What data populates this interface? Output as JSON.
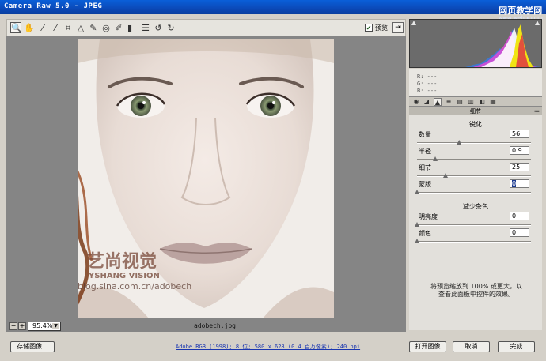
{
  "window": {
    "title": "Camera Raw 5.0 -  JPEG",
    "watermark": {
      "line1": "网页教学网",
      "line2": "www.webjx.com"
    }
  },
  "toolbar": {
    "tools": [
      {
        "icon": "zoom-icon",
        "glyph": "🔍"
      },
      {
        "icon": "hand-icon",
        "glyph": "✋"
      },
      {
        "icon": "white-balance-icon",
        "glyph": "⁄"
      },
      {
        "icon": "color-sampler-icon",
        "glyph": "⁄"
      },
      {
        "icon": "crop-icon",
        "glyph": "⌗"
      },
      {
        "icon": "straighten-icon",
        "glyph": "△"
      },
      {
        "icon": "spot-removal-icon",
        "glyph": "✎"
      },
      {
        "icon": "red-eye-icon",
        "glyph": "◎"
      },
      {
        "icon": "adjustment-brush-icon",
        "glyph": "✐"
      },
      {
        "icon": "gradient-filter-icon",
        "glyph": "▮"
      },
      {
        "icon": "preferences-icon",
        "glyph": "☰"
      },
      {
        "icon": "rotate-ccw-icon",
        "glyph": "↺"
      },
      {
        "icon": "rotate-cw-icon",
        "glyph": "↻"
      }
    ],
    "preview_label": "预览",
    "preview_checked": "✔",
    "fullscreen_glyph": "⇥"
  },
  "status": {
    "zoom_minus": "−",
    "zoom_plus": "+",
    "zoom_value": "95.4%",
    "zoom_arrow": "▼",
    "filename": "adobech.jpg"
  },
  "photo_overlay": {
    "brand_cn": "艺尚视觉",
    "brand_en": "YSHANG VISION",
    "blog": "blog.sina.com.cn/adobech"
  },
  "readout": {
    "r": "R:  ---",
    "g": "G:  ---",
    "b": "B:  ---"
  },
  "panel": {
    "title": "细节",
    "sharpen": {
      "heading": "锐化",
      "rows": [
        {
          "label": "数量",
          "value": "56",
          "pos": 0.37
        },
        {
          "label": "半径",
          "value": "0.9",
          "pos": 0.16
        },
        {
          "label": "细节",
          "value": "25",
          "pos": 0.25
        },
        {
          "label": "蒙版",
          "value": "0",
          "pos": 0.0
        }
      ]
    },
    "noise": {
      "heading": "减少杂色",
      "rows": [
        {
          "label": "明亮度",
          "value": "0",
          "pos": 0.0
        },
        {
          "label": "颜色",
          "value": "0",
          "pos": 0.0
        }
      ]
    },
    "info_line1": "将预览缩放到 100% 或更大，以",
    "info_line2": "查看此面板中控件的效果。"
  },
  "bottom": {
    "save_label": "存储图像...",
    "info_link": "Adobe RGB (1998); 8 位; 580 x 628 (0.4 百万像素); 240 ppi",
    "open_label": "打开图像",
    "cancel_label": "取消",
    "done_label": "完成"
  }
}
